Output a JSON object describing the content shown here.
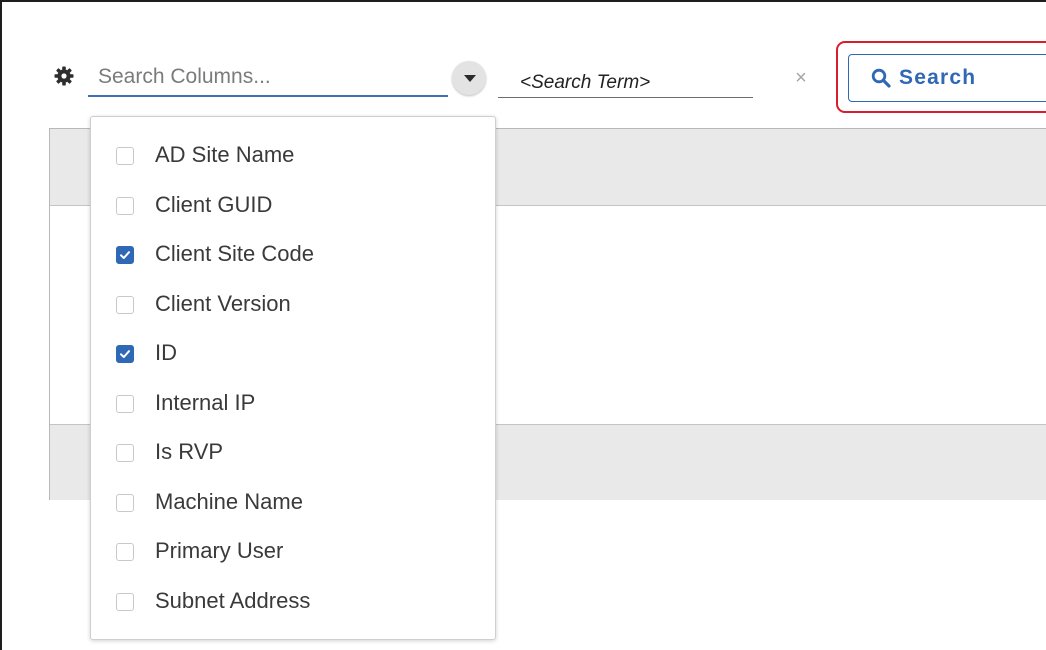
{
  "toolbar": {
    "column_search_placeholder": "Search Columns...",
    "search_term_placeholder": "<Search Term>",
    "clear_label": "×",
    "search_button_label": "Search"
  },
  "column_menu": {
    "items": [
      {
        "label": "AD Site Name",
        "checked": false
      },
      {
        "label": "Client GUID",
        "checked": false
      },
      {
        "label": "Client Site Code",
        "checked": true
      },
      {
        "label": "Client Version",
        "checked": false
      },
      {
        "label": "ID",
        "checked": true
      },
      {
        "label": "Internal IP",
        "checked": false
      },
      {
        "label": "Is RVP",
        "checked": false
      },
      {
        "label": "Machine Name",
        "checked": false
      },
      {
        "label": "Primary User",
        "checked": false
      },
      {
        "label": "Subnet Address",
        "checked": false
      }
    ]
  },
  "colors": {
    "accent": "#2f68b5",
    "highlight": "#d81e2c"
  },
  "icons": {
    "settings": "gear-icon",
    "dropdown": "caret-down-icon",
    "clear": "close-icon",
    "search": "search-icon",
    "checkbox_checked": "checkmark-icon"
  }
}
